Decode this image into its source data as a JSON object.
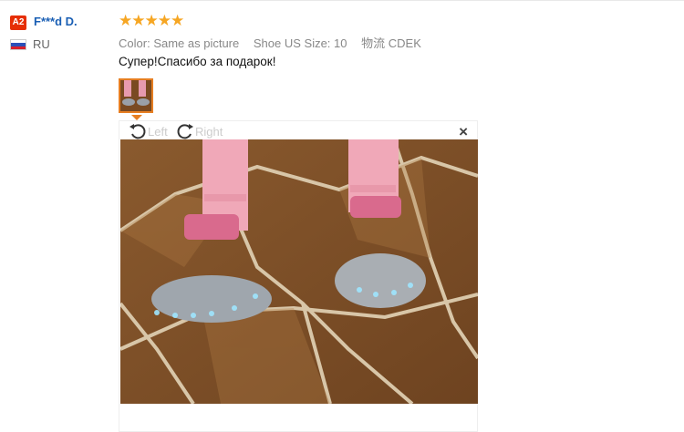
{
  "user": {
    "avatar_text": "A2",
    "name": "F***d D.",
    "country": "RU"
  },
  "review": {
    "rating": 5,
    "stars": "★★★★★",
    "attributes": [
      {
        "label": "Color:",
        "value": "Same as picture"
      },
      {
        "label": "Shoe US Size:",
        "value": "10"
      },
      {
        "label": "物流",
        "value": "CDEK"
      }
    ],
    "text": "Супер!Спасибо за подарок!"
  },
  "viewer": {
    "rotate_left": "Left",
    "rotate_right": "Right",
    "close": "×"
  },
  "colors": {
    "accent": "#e67e22",
    "star": "#f6a623",
    "name": "#1a5fb4",
    "badge": "#e62e04"
  }
}
